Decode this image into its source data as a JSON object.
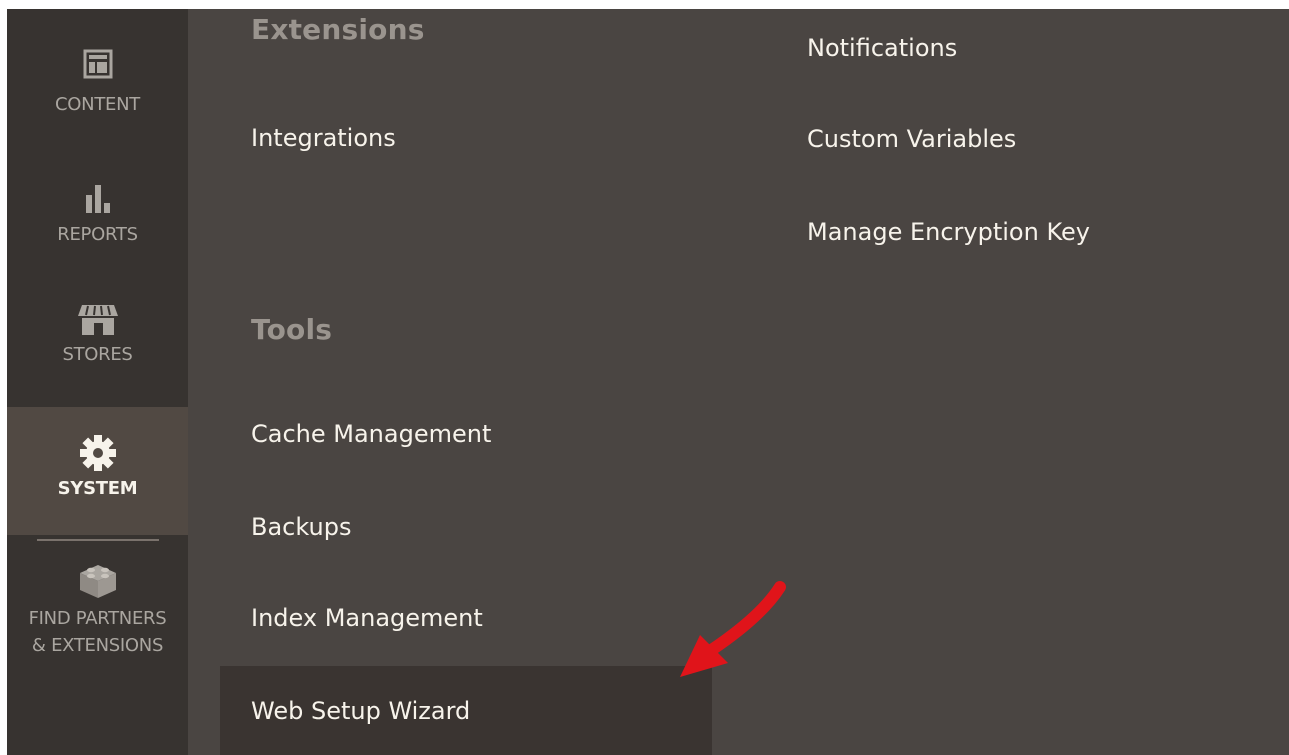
{
  "sidebar": {
    "items": [
      {
        "id": "content",
        "label": "CONTENT",
        "icon": "layout-icon"
      },
      {
        "id": "reports",
        "label": "REPORTS",
        "icon": "bar-chart-icon"
      },
      {
        "id": "stores",
        "label": "STORES",
        "icon": "storefront-icon"
      },
      {
        "id": "system",
        "label": "SYSTEM",
        "icon": "gear-icon",
        "active": true
      },
      {
        "id": "find-partners",
        "label_line1": "FIND PARTNERS",
        "label_line2": "& EXTENSIONS",
        "icon": "lego-brick-icon"
      }
    ]
  },
  "menu": {
    "extensions": {
      "heading": "Extensions",
      "items": [
        "Integrations"
      ]
    },
    "tools": {
      "heading": "Tools",
      "items": [
        "Cache Management",
        "Backups",
        "Index Management",
        "Web Setup Wizard"
      ]
    },
    "other_settings": {
      "items": [
        "Notifications",
        "Custom Variables",
        "Manage Encryption Key"
      ]
    }
  },
  "colors": {
    "sidebar_bg": "#373330",
    "sidebar_active_bg": "#514943",
    "panel_bg": "#4a4542",
    "highlight_bg": "#3a3431",
    "heading_text": "#9a948e",
    "link_text": "#f7f3eb",
    "annotation_arrow": "#e0141a"
  }
}
